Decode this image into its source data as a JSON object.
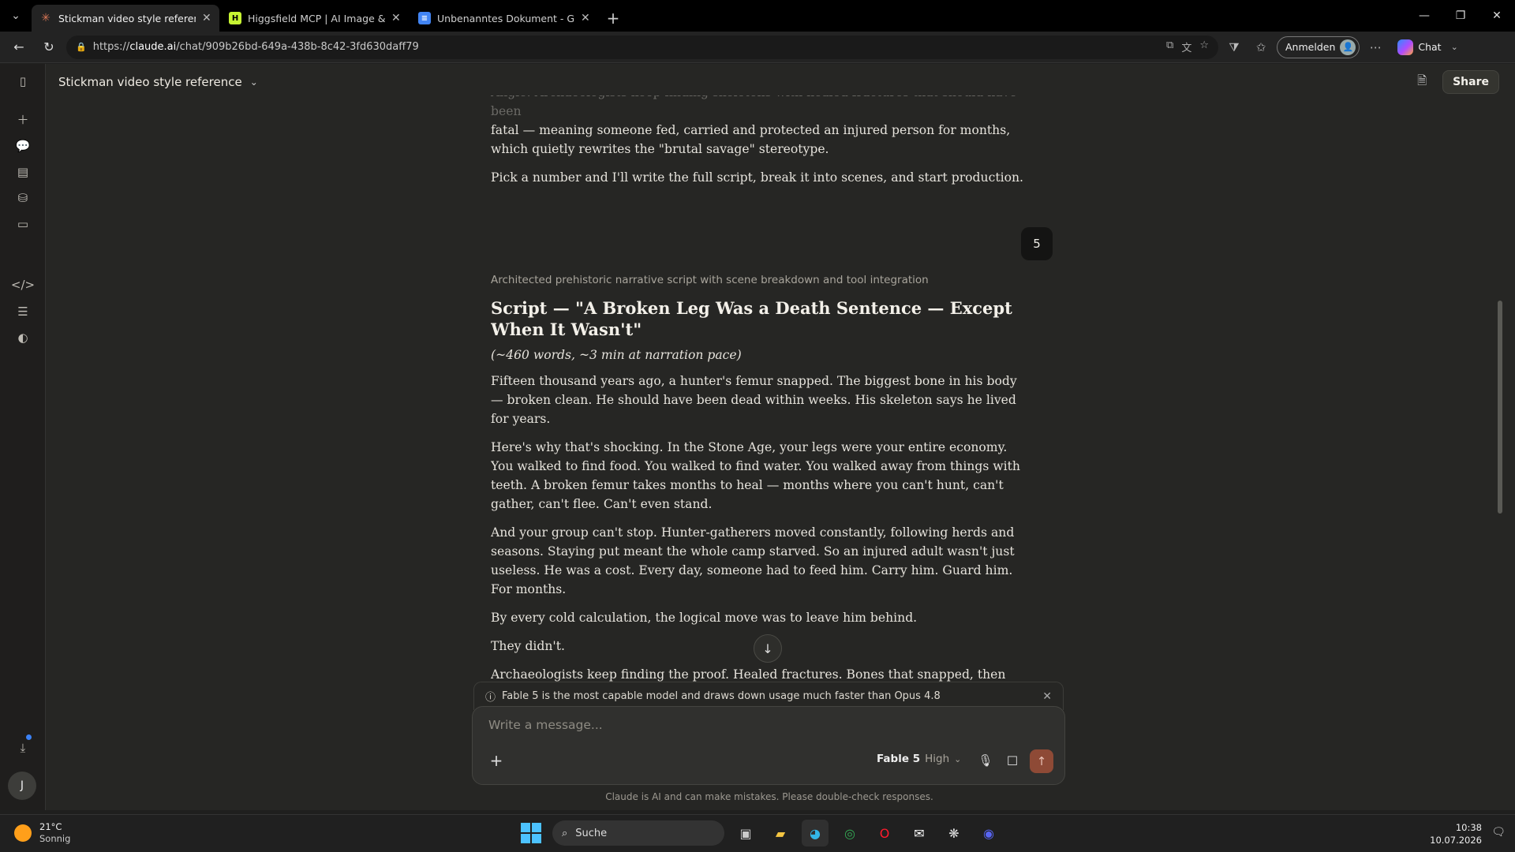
{
  "browser": {
    "tabs": [
      {
        "title": "Stickman video style reference - Cl",
        "active": true,
        "fav_color": "#d97757"
      },
      {
        "title": "Higgsfield MCP | AI Image & Video",
        "active": false,
        "fav_color": "#c6f432"
      },
      {
        "title": "Unbenanntes Dokument - Google",
        "active": false,
        "fav_color": "#4285f4"
      }
    ],
    "url_scheme": "https://",
    "url_host": "claude.ai",
    "url_path": "/chat/909b26bd-649a-438b-8c42-3fd630daff79",
    "signin_label": "Anmelden",
    "copilot_label": "Chat"
  },
  "app": {
    "chat_title": "Stickman video style reference",
    "share_label": "Share",
    "user_initial": "J"
  },
  "conversation": {
    "prev_faded": "Angle: Archaeologists keep finding skeletons with healed fractures that should have been",
    "prev_1": "fatal — meaning someone fed, carried and protected an injured person for months, which quietly rewrites the \"brutal savage\" stereotype.",
    "prev_2": "Pick a number and I'll write the full script, break it into scenes, and start production.",
    "user_reply": "5",
    "thinking": "Architected prehistoric narrative script with scene breakdown and tool integration",
    "heading": "Script — \"A Broken Leg Was a Death Sentence — Except When It Wasn't\"",
    "meta": "(~460 words, ~3 min at narration pace)",
    "paras": [
      "Fifteen thousand years ago, a hunter's femur snapped. The biggest bone in his body — broken clean. He should have been dead within weeks. His skeleton says he lived for years.",
      "Here's why that's shocking. In the Stone Age, your legs were your entire economy. You walked to find food. You walked to find water. You walked away from things with teeth. A broken femur takes months to heal — months where you can't hunt, can't gather, can't flee. Can't even stand.",
      "And your group can't stop. Hunter-gatherers moved constantly, following herds and seasons. Staying put meant the whole camp starved. So an injured adult wasn't just useless. He was a cost. Every day, someone had to feed him. Carry him. Guard him. For months.",
      "By every cold calculation, the logical move was to leave him behind.",
      "They didn't.",
      "Archaeologists keep finding the proof. Healed fractures. Bones that snapped, then slowly"
    ]
  },
  "composer": {
    "notice": "Fable 5 is the most capable model and draws down usage much faster than Opus 4.8",
    "placeholder": "Write a message...",
    "model": "Fable 5",
    "effort": "High",
    "disclaimer": "Claude is AI and can make mistakes. Please double-check responses."
  },
  "taskbar": {
    "temp": "21°C",
    "condition": "Sonnig",
    "search_label": "Suche",
    "time": "10:38",
    "date": "10.07.2026"
  }
}
